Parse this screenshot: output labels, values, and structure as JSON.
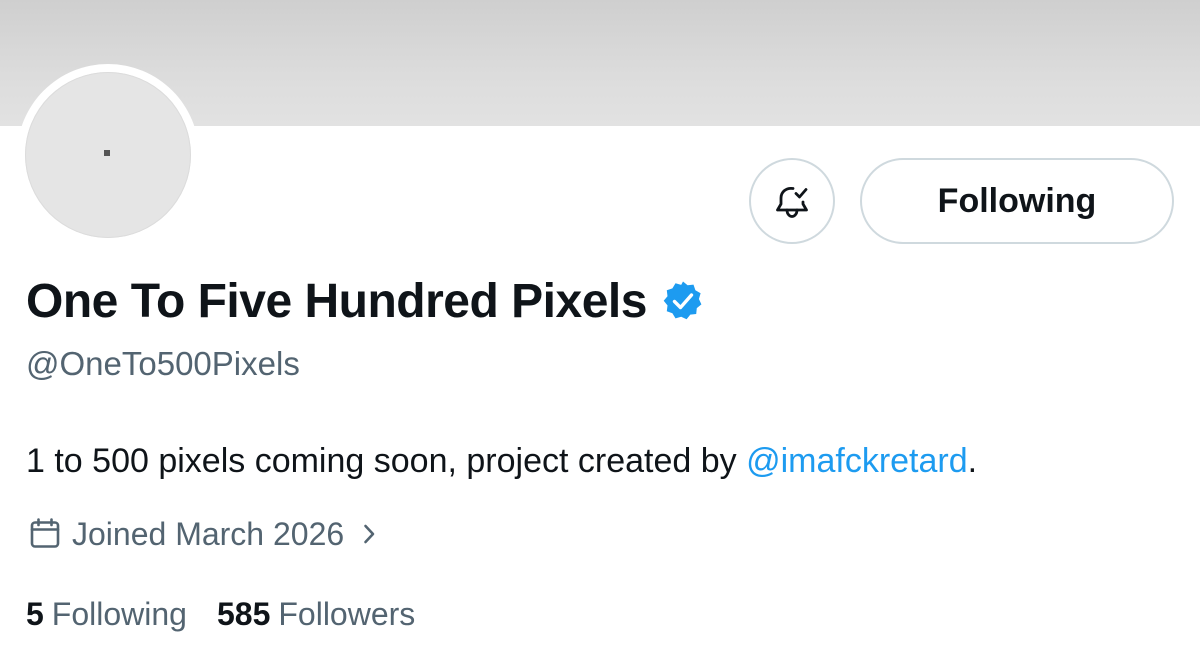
{
  "profile": {
    "display_name": "One To Five Hundred Pixels",
    "handle": "@OneTo500Pixels",
    "bio": {
      "text": "1 to 500 pixels coming soon, project created by ",
      "mention": "@imafckretard",
      "trailing": "."
    },
    "joined": "Joined March 2026",
    "following_count": "5",
    "following_label": "Following",
    "followers_count": "585",
    "followers_label": "Followers",
    "verified": true
  },
  "actions": {
    "follow_button_label": "Following",
    "notify_icon": "bell-check-icon"
  },
  "icons": {
    "verified": "verified-badge-icon",
    "calendar": "calendar-icon",
    "chevron": "chevron-right-icon"
  },
  "colors": {
    "accent": "#1d9bf0",
    "text": "#0f1419",
    "secondary_text": "#536471",
    "border": "#cfd9de",
    "banner": "#d9d9d9",
    "avatar_bg": "#e5e5e5"
  }
}
